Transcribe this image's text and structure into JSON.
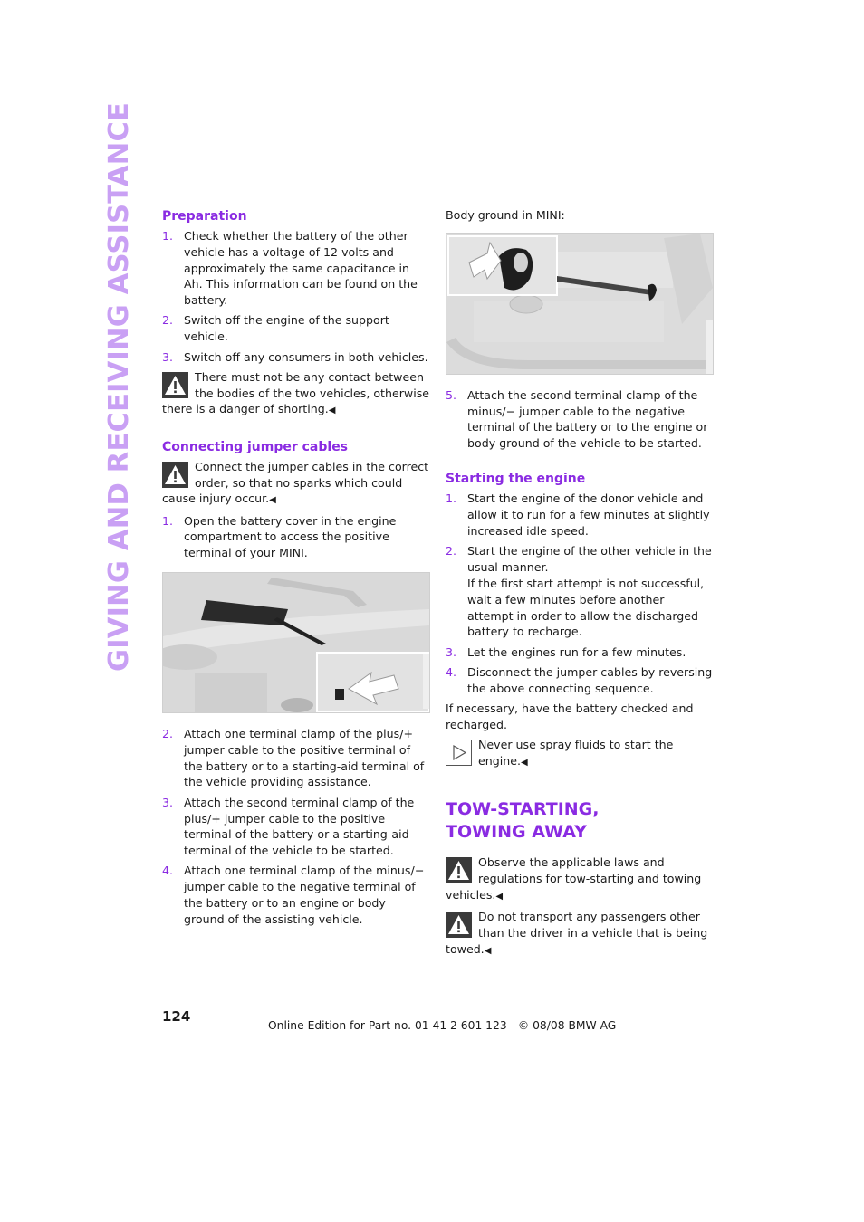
{
  "side_title": "GIVING AND RECEIVING ASSISTANCE",
  "colors": {
    "accent": "#8a2be2",
    "side_title": "#c9a0f4",
    "text": "#1a1a1a"
  },
  "left": {
    "preparation": {
      "heading": "Preparation",
      "items": [
        {
          "num": "1.",
          "text": "Check whether the battery of the other vehicle has a voltage of 12 volts and approximately the same capacitance in Ah. This information can be found on the battery."
        },
        {
          "num": "2.",
          "text": "Switch off the engine of the support vehicle."
        },
        {
          "num": "3.",
          "text": "Switch off any consumers in both vehicles."
        }
      ],
      "warning": {
        "icon": "warning-triangle-icon",
        "text": "There must not be any contact between the bodies of the two vehicles, otherwise there is a danger of shorting.",
        "end_mark": "◀"
      }
    },
    "connecting": {
      "heading": "Connecting jumper cables",
      "warning": {
        "icon": "warning-triangle-icon",
        "text": "Connect the jumper cables in the correct order, so that no sparks which could cause injury occur.",
        "end_mark": "◀"
      },
      "items_before_figure": [
        {
          "num": "1.",
          "text": "Open the battery cover in the engine compartment to access the positive terminal of your MINI."
        }
      ],
      "figure": {
        "description": "Engine compartment with battery cover and positive terminal callout"
      },
      "items_after_figure": [
        {
          "num": "2.",
          "text": "Attach one terminal clamp of the plus/+ jumper cable to the positive terminal of the battery or to a starting-aid terminal of the vehicle providing assistance."
        },
        {
          "num": "3.",
          "text": "Attach the second terminal clamp of the plus/+ jumper cable to the positive terminal of the battery or a starting-aid terminal of the vehicle to be started."
        },
        {
          "num": "4.",
          "text": "Attach one terminal clamp of the minus/− jumper cable to the negative terminal of the battery or to an engine or body ground of the assisting vehicle."
        }
      ]
    }
  },
  "right": {
    "body_ground_label": "Body ground in MINI:",
    "figure": {
      "description": "Engine with body ground point callout"
    },
    "connecting_cont": [
      {
        "num": "5.",
        "text": "Attach the second terminal clamp of the minus/− jumper cable to the negative terminal of the battery or to the engine or body ground of the vehicle to be started."
      }
    ],
    "starting": {
      "heading": "Starting the engine",
      "items": [
        {
          "num": "1.",
          "text": "Start the engine of the donor vehicle and allow it to run for a few minutes at slightly increased idle speed."
        },
        {
          "num": "2.",
          "text": "Start the engine of the other vehicle in the usual manner.",
          "extra": "If the first start attempt is not successful, wait a few minutes before another attempt in order to allow the discharged battery to recharge."
        },
        {
          "num": "3.",
          "text": "Let the engines run for a few minutes."
        },
        {
          "num": "4.",
          "text": "Disconnect the jumper cables by reversing the above connecting sequence."
        }
      ],
      "after": "If necessary, have the battery checked and recharged.",
      "tip": {
        "icon": "tip-play-icon",
        "text": "Never use spray fluids to start the engine.",
        "end_mark": "◀"
      }
    },
    "towing": {
      "heading_line1": "TOW-STARTING,",
      "heading_line2": "TOWING AWAY",
      "warnings": [
        {
          "icon": "warning-triangle-icon",
          "text": "Observe the applicable laws and regulations for tow-starting and towing vehicles.",
          "end_mark": "◀"
        },
        {
          "icon": "warning-triangle-icon",
          "text": "Do not transport any passengers other than the driver in a vehicle that is being towed.",
          "end_mark": "◀"
        }
      ]
    }
  },
  "page_number": "124",
  "footer": "Online Edition for Part no. 01 41 2 601 123  - © 08/08 BMW AG"
}
